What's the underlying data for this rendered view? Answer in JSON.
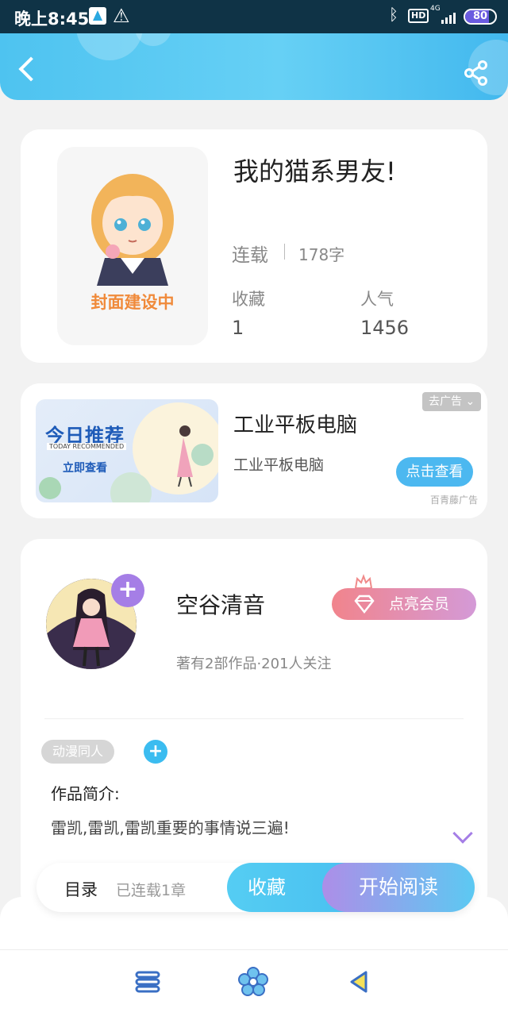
{
  "status_bar": {
    "time": "晚上8:45",
    "hd": "HD",
    "network": "4G",
    "battery_percent": 80,
    "battery_label": "80"
  },
  "book": {
    "cover_label": "封面建设中",
    "title": "我的猫系男友!",
    "status": "连载",
    "word_count": "178字",
    "stats": [
      {
        "label": "收藏",
        "value": "1"
      },
      {
        "label": "人气",
        "value": "1456"
      }
    ]
  },
  "ad": {
    "banner_title": "今日推荐",
    "banner_subtitle": "TODAY RECOMMENDED",
    "banner_cta": "立即查看",
    "title": "工业平板电脑",
    "subtitle": "工业平板电脑",
    "remove_label": "去广告",
    "view_label": "点击查看",
    "source": "百青藤广告"
  },
  "author": {
    "name": "空谷清音",
    "meta": "著有2部作品·201人关注",
    "vip_label": "点亮会员",
    "tag": "动漫同人",
    "intro_title": "作品简介:",
    "intro_text": "雷凯,雷凯,雷凯重要的事情说三遍!"
  },
  "actions": {
    "toc_label": "目录",
    "chapters": "已连载1章",
    "collect_label": "收藏",
    "read_label": "开始阅读"
  },
  "colors": {
    "primary": "#4ec3f0",
    "accent_purple": "#a57ee6",
    "cover_text": "#f08a3a",
    "vip_start": "#f1848c"
  }
}
